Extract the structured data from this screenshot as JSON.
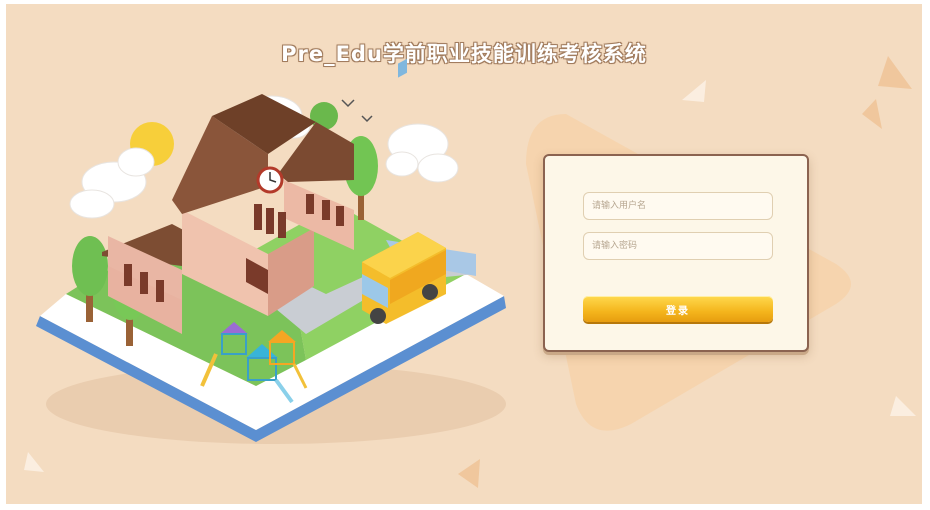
{
  "app": {
    "title": "Pre_Edu学前职业技能训练考核系统"
  },
  "login": {
    "username_placeholder": "请输入用户名",
    "password_placeholder": "请输入密码",
    "submit_label": "登录"
  },
  "theme": {
    "background": "#f4dcc1",
    "accent": "#f4b51c",
    "card_border": "#8b6350"
  },
  "illustration": {
    "subject": "school-on-open-book-illustration",
    "elements": [
      "school-building-icon",
      "clock-icon",
      "school-bus-icon",
      "playground-icon",
      "tree-icon",
      "cloud-icon",
      "sun-icon",
      "bird-icon"
    ]
  }
}
